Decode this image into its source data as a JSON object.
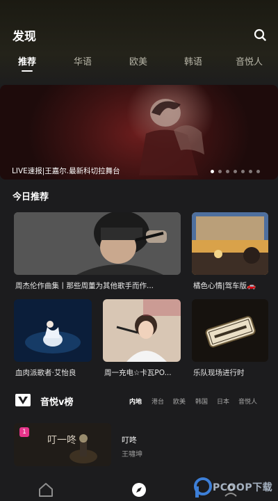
{
  "header": {
    "title": "发现"
  },
  "tabs": [
    {
      "label": "推荐"
    },
    {
      "label": "华语"
    },
    {
      "label": "欧美"
    },
    {
      "label": "韩语"
    },
    {
      "label": "音悦人"
    }
  ],
  "banner": {
    "caption": "LIVE速报|王嘉尔.最新科切拉舞台",
    "slide_count": 7,
    "active_slide": 1
  },
  "today": {
    "title": "今日推荐",
    "cards": [
      {
        "label": "周杰伦作曲集丨那些周董为其他歌手而作..."
      },
      {
        "label": "橘色心情|驾车版🚗"
      },
      {
        "label": "血肉派歌者·艾怡良"
      },
      {
        "label": "周一充电☆卡瓦PO..."
      },
      {
        "label": "乐队现场进行时"
      }
    ]
  },
  "vbang": {
    "title": "音悦v榜",
    "regions": [
      "内地",
      "港台",
      "欧美",
      "韩国",
      "日本",
      "音悦人"
    ],
    "active_region": "内地",
    "items": [
      {
        "rank": "1",
        "title": "叮咚",
        "artist": "王嘯坤",
        "cover_text": "叮一咚"
      }
    ]
  },
  "watermark": {
    "text": "PCOOP下载"
  },
  "colors": {
    "background": "#1c1c1e",
    "rank_badge": "#e6358b",
    "tab_inactive": "#b8b6a8"
  },
  "icons": {
    "search": "search-icon",
    "home": "home-icon",
    "discover": "compass-icon",
    "profile": "profile-icon"
  }
}
